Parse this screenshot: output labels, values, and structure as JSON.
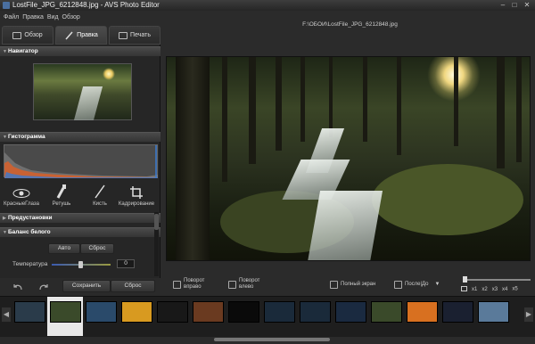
{
  "window": {
    "title": "LostFile_JPG_6212848.jpg - AVS Photo Editor",
    "minimize": "–",
    "maximize": "□",
    "close": "✕"
  },
  "menu": [
    "Файл",
    "Правка",
    "Вид",
    "Обзор"
  ],
  "file_path": "F:\\ОБОИ\\LostFile_JPG_6212848.jpg",
  "tabs": [
    {
      "label": "Обзор",
      "icon": "folder-icon"
    },
    {
      "label": "Правка",
      "icon": "brush-icon"
    },
    {
      "label": "Печать",
      "icon": "printer-icon"
    }
  ],
  "sections": {
    "navigator": "Навигатор",
    "histogram": "Гистограмма",
    "presets": "Предустановки",
    "white_balance": "Баланс белого"
  },
  "tools": [
    {
      "label": "КрасныеГлаза",
      "icon": "eye-icon"
    },
    {
      "label": "Ретушь",
      "icon": "retouch-icon"
    },
    {
      "label": "Кисть",
      "icon": "brush-icon"
    },
    {
      "label": "Кадрирование",
      "icon": "crop-icon"
    }
  ],
  "white_balance": {
    "auto_label": "Авто",
    "reset_label": "Сброс",
    "temperature_label": "Температура",
    "temperature_value": "0",
    "temperature_level": 0.5
  },
  "bottom": {
    "save_label": "Сохранить",
    "reset_label": "Сброс"
  },
  "view_toolbar": {
    "rotate_right": "Поворот\nвправо",
    "rotate_left": "Поворот\nвлево",
    "fullscreen": "Полный экран",
    "before_after": "После|До"
  },
  "zoom": {
    "labels": [
      "x1",
      "x2",
      "x3",
      "x4",
      "x5"
    ]
  },
  "colors": {
    "accent": "#e8e8e8",
    "bg": "#2b2b2b",
    "histogram_red": "#d8602a",
    "histogram_blue": "#3a7ad0"
  },
  "filmstrip": {
    "thumbs": [
      "#2a3b4a",
      "#3a4a2a",
      "#2a4a6a",
      "#d89a20",
      "#181818",
      "#6a3a20",
      "#0a0a0a",
      "#1a2a3a",
      "#1a2a3a",
      "#1a2a40",
      "#3a4a2a",
      "#d87020",
      "#1a2030",
      "#5a7a9a"
    ],
    "selected_index": 1
  }
}
